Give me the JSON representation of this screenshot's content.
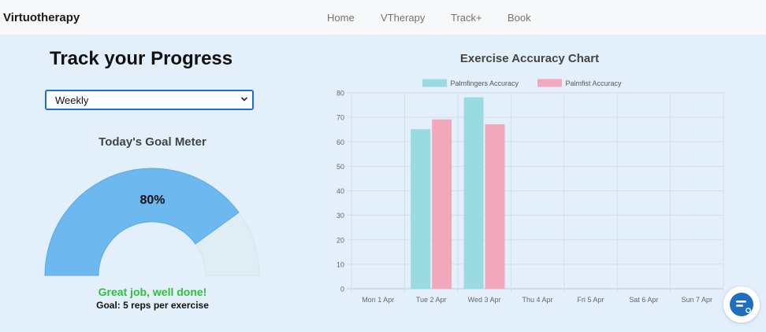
{
  "navbar": {
    "brand": "Virtuotherapy",
    "links": [
      "Home",
      "VTherapy",
      "Track+",
      "Book"
    ]
  },
  "progress": {
    "title": "Track your Progress",
    "period_select": {
      "value": "Weekly"
    }
  },
  "goal_meter": {
    "title": "Today's Goal Meter",
    "value_label": "80%",
    "fraction": 0.8,
    "message": "Great job, well done!",
    "goal": "Goal: 5 reps per exercise",
    "colors": {
      "fill": "#6cb8ef",
      "track": "#e1edf4",
      "message": "#2fbf3a"
    }
  },
  "chart_data": {
    "type": "bar",
    "title": "Exercise Accuracy Chart",
    "categories": [
      "Mon 1 Apr",
      "Tue 2 Apr",
      "Wed 3 Apr",
      "Thu 4 Apr",
      "Fri 5 Apr",
      "Sat 6 Apr",
      "Sun 7 Apr"
    ],
    "series": [
      {
        "name": "Palmfingers Accuracy",
        "color": "#9adbe2",
        "values": [
          null,
          65,
          78,
          null,
          null,
          null,
          null
        ]
      },
      {
        "name": "Palmfist Accuracy",
        "color": "#f2a8bb",
        "values": [
          null,
          69,
          67,
          null,
          null,
          null,
          null
        ]
      }
    ],
    "ylim": [
      0,
      80
    ],
    "yticks": [
      0,
      10,
      20,
      30,
      40,
      50,
      60,
      70,
      80
    ],
    "grid": true,
    "legend": "top"
  },
  "chat": {
    "icon": "chat-icon"
  }
}
